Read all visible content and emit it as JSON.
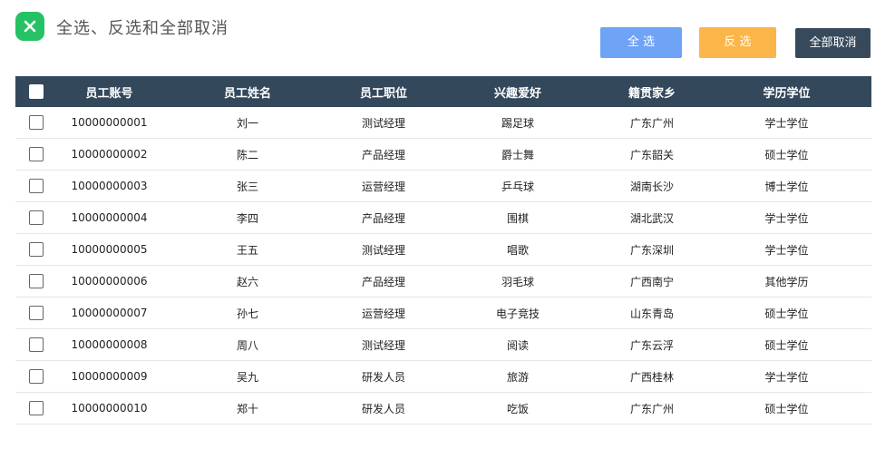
{
  "header": {
    "title": "全选、反选和全部取消",
    "select_all_label": "全 选",
    "invert_label": "反 选",
    "cancel_all_label": "全部取消"
  },
  "colors": {
    "app_icon": "#27c165",
    "select_all": "#6ea3f6",
    "invert": "#fbb548",
    "cancel_all": "#374a5c",
    "table_header": "#34485c"
  },
  "table": {
    "headers": [
      "员工账号",
      "员工姓名",
      "员工职位",
      "兴趣爱好",
      "籍贯家乡",
      "学历学位"
    ],
    "rows": [
      [
        "10000000001",
        "刘一",
        "测试经理",
        "踢足球",
        "广东广州",
        "学士学位"
      ],
      [
        "10000000002",
        "陈二",
        "产品经理",
        "爵士舞",
        "广东韶关",
        "硕士学位"
      ],
      [
        "10000000003",
        "张三",
        "运营经理",
        "乒乓球",
        "湖南长沙",
        "博士学位"
      ],
      [
        "10000000004",
        "李四",
        "产品经理",
        "围棋",
        "湖北武汉",
        "学士学位"
      ],
      [
        "10000000005",
        "王五",
        "测试经理",
        "唱歌",
        "广东深圳",
        "学士学位"
      ],
      [
        "10000000006",
        "赵六",
        "产品经理",
        "羽毛球",
        "广西南宁",
        "其他学历"
      ],
      [
        "10000000007",
        "孙七",
        "运营经理",
        "电子竞技",
        "山东青岛",
        "硕士学位"
      ],
      [
        "10000000008",
        "周八",
        "测试经理",
        "阅读",
        "广东云浮",
        "硕士学位"
      ],
      [
        "10000000009",
        "吴九",
        "研发人员",
        "旅游",
        "广西桂林",
        "学士学位"
      ],
      [
        "10000000010",
        "郑十",
        "研发人员",
        "吃饭",
        "广东广州",
        "硕士学位"
      ]
    ]
  }
}
